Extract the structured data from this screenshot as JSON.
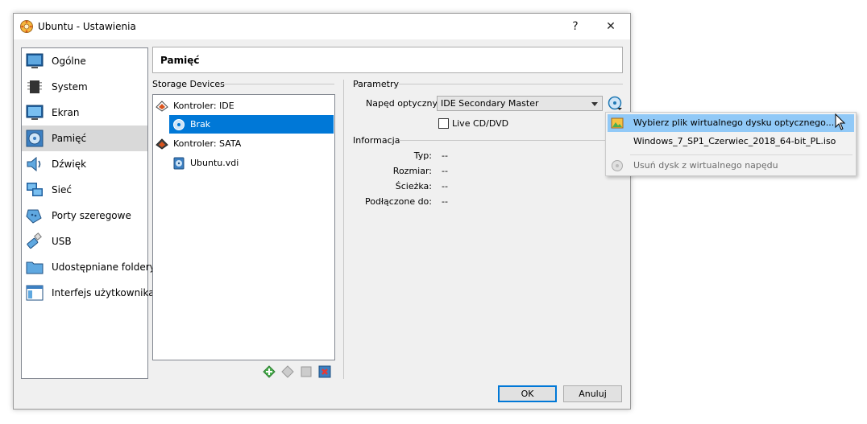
{
  "window": {
    "title": "Ubuntu - Ustawienia",
    "help": "?",
    "close": "✕"
  },
  "sidebar": {
    "items": [
      {
        "label": "Ogólne",
        "icon": "general-icon"
      },
      {
        "label": "System",
        "icon": "system-chip-icon"
      },
      {
        "label": "Ekran",
        "icon": "display-monitor-icon"
      },
      {
        "label": "Pamięć",
        "icon": "storage-disc-icon",
        "selected": true
      },
      {
        "label": "Dźwięk",
        "icon": "audio-speaker-icon"
      },
      {
        "label": "Sieć",
        "icon": "network-icon"
      },
      {
        "label": "Porty szeregowe",
        "icon": "serial-port-icon"
      },
      {
        "label": "USB",
        "icon": "usb-icon"
      },
      {
        "label": "Udostępniane foldery",
        "icon": "shared-folder-icon"
      },
      {
        "label": "Interfejs użytkownika",
        "icon": "user-interface-icon"
      }
    ]
  },
  "header": {
    "title": "Pamięć"
  },
  "storage": {
    "group_title": "Storage Devices",
    "tree": [
      {
        "label": "Kontroler: IDE",
        "level": 0
      },
      {
        "label": "Brak",
        "level": 1,
        "selected": true
      },
      {
        "label": "Kontroler: SATA",
        "level": 0
      },
      {
        "label": "Ubuntu.vdi",
        "level": 1
      }
    ]
  },
  "params": {
    "group_title": "Parametry",
    "optical_label": "Napęd optyczny:",
    "optical_value": "IDE Secondary Master",
    "live_cd_label": "Live CD/DVD"
  },
  "info": {
    "group_title": "Informacja",
    "rows": [
      {
        "label": "Typ:",
        "value": "--"
      },
      {
        "label": "Rozmiar:",
        "value": "--"
      },
      {
        "label": "Ścieżka:",
        "value": "--"
      },
      {
        "label": "Podłączone do:",
        "value": "--"
      }
    ]
  },
  "buttons": {
    "ok": "OK",
    "cancel": "Anuluj"
  },
  "menu": {
    "items": [
      {
        "label": "Wybierz plik wirtualnego dysku optycznego...",
        "highlighted": true
      },
      {
        "label": "Windows_7_SP1_Czerwiec_2018_64-bit_PL.iso"
      },
      {
        "label": "Usuń dysk z wirtualnego napędu",
        "disabled": true
      }
    ]
  },
  "colors": {
    "selection": "#0078d7",
    "menu_highlight": "#91c9f7",
    "sidebar_selected": "#d9d9d9"
  }
}
